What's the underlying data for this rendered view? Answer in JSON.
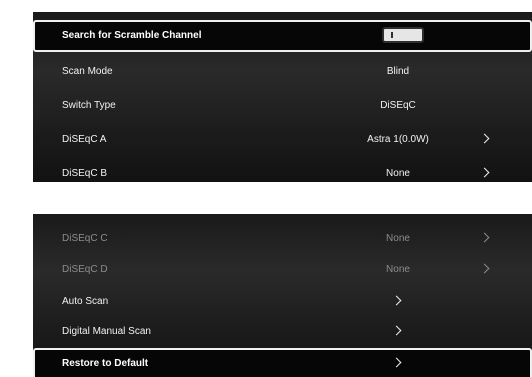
{
  "top_panel": {
    "items": [
      {
        "label": "Search for Scramble Channel",
        "type": "toggle",
        "toggle_on": false
      },
      {
        "label": "Scan Mode",
        "value": "Blind"
      },
      {
        "label": "Switch Type",
        "value": "DiSEqC"
      },
      {
        "label": "DiSEqC A",
        "value": "Astra 1(0.0W)",
        "icon": "chevron-right-icon"
      },
      {
        "label": "DiSEqC B",
        "value": "None",
        "icon": "chevron-right-icon"
      }
    ]
  },
  "bottom_panel": {
    "items": [
      {
        "label": "DiSEqC C",
        "value": "None",
        "icon": "chevron-right-icon"
      },
      {
        "label": "DiSEqC D",
        "value": "None",
        "icon": "chevron-right-icon"
      },
      {
        "label": "Auto Scan",
        "icon": "chevron-right-icon"
      },
      {
        "label": "Digital Manual Scan",
        "icon": "chevron-right-icon"
      },
      {
        "label": "Restore to Default",
        "icon": "chevron-right-icon"
      }
    ]
  },
  "colors": {
    "text": "#f2f2f2",
    "text_dim": "#8c8c8c",
    "focus_border": "#f0f0f0",
    "toggle_track": "#e6e6e6"
  }
}
